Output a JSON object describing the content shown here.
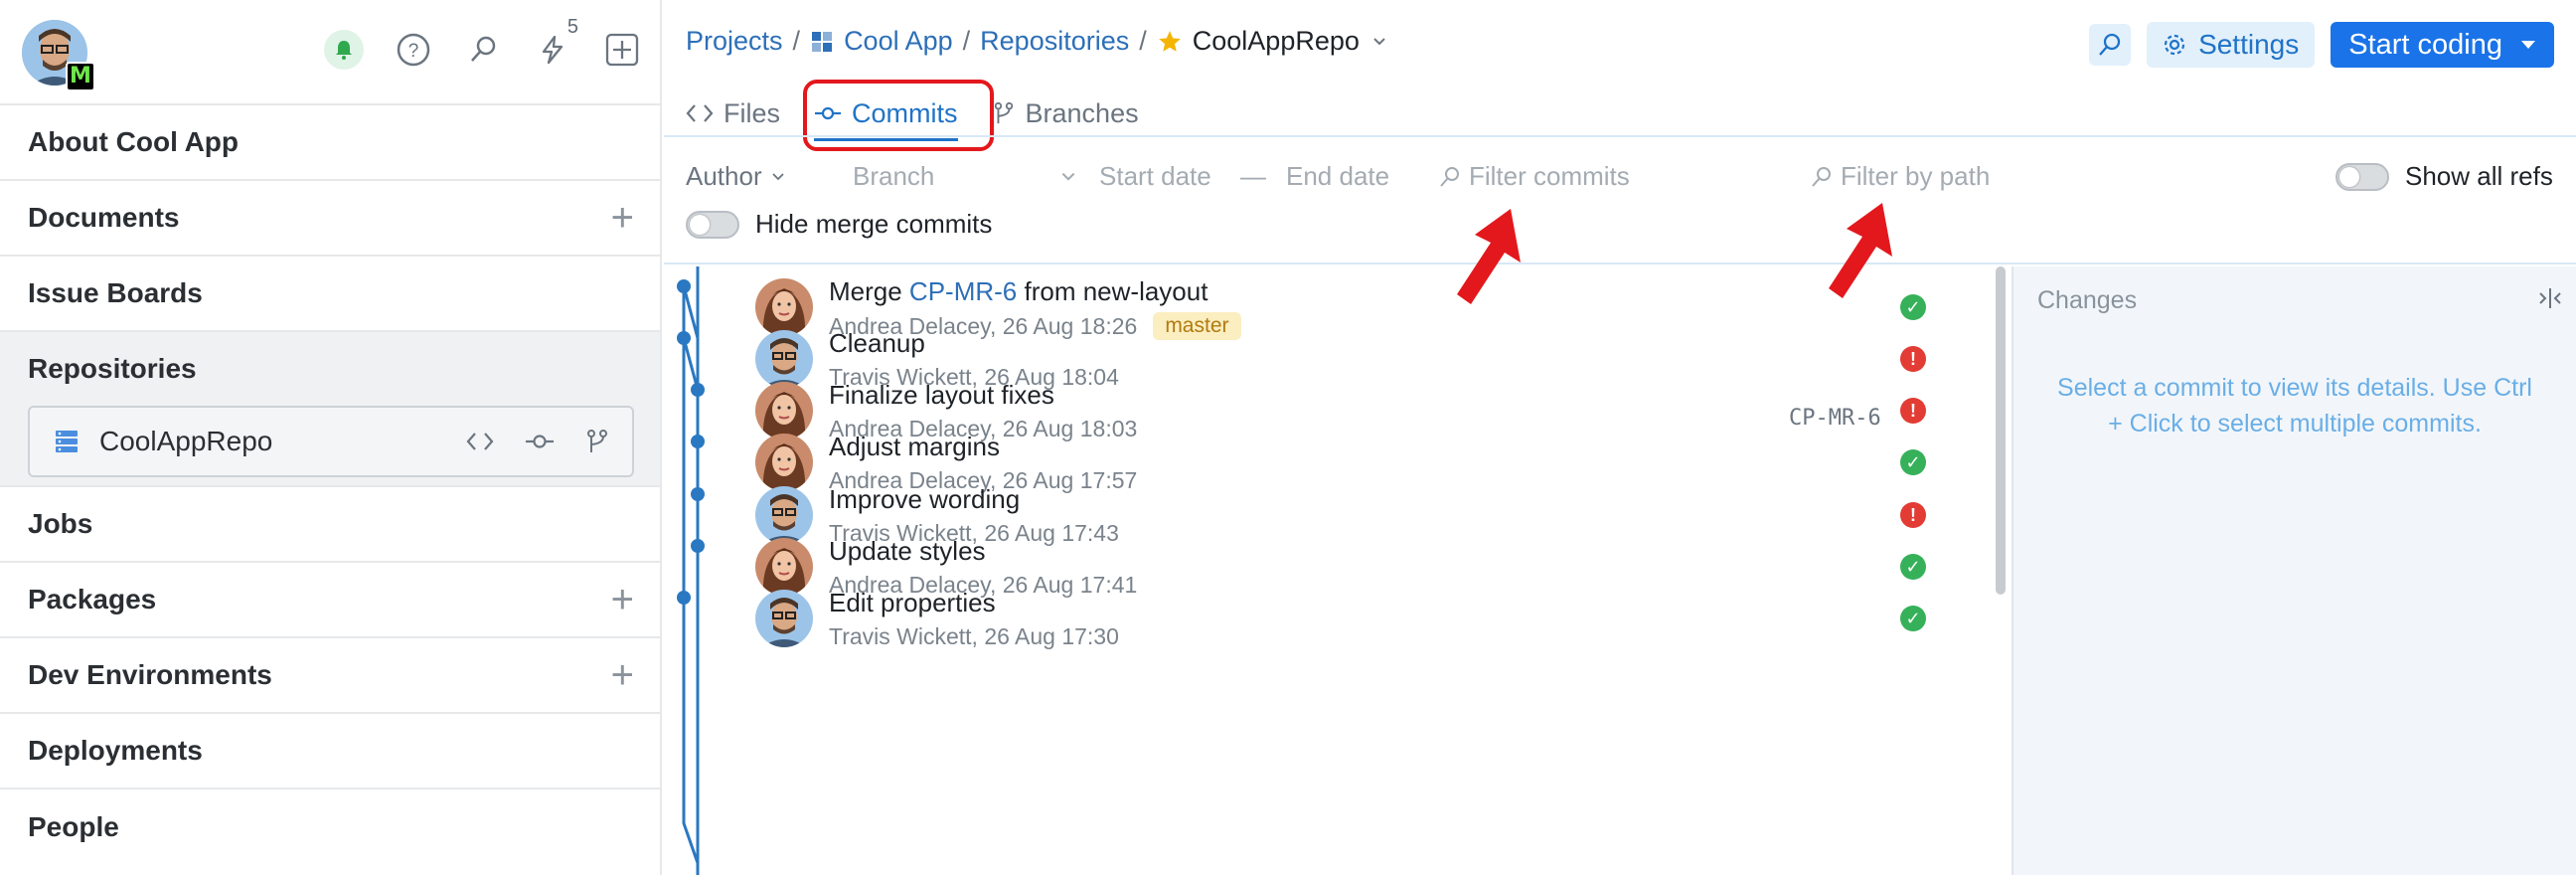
{
  "sidebar": {
    "notifications_count": "5",
    "avatar_badge": "M",
    "items": [
      {
        "label": "About Cool App",
        "has_add": false
      },
      {
        "label": "Documents",
        "has_add": true
      },
      {
        "label": "Issue Boards",
        "has_add": false
      }
    ],
    "repositories": {
      "label": "Repositories",
      "repo_name": "CoolAppRepo"
    },
    "items_after": [
      {
        "label": "Jobs",
        "has_add": false
      },
      {
        "label": "Packages",
        "has_add": true
      },
      {
        "label": "Dev Environments",
        "has_add": true
      },
      {
        "label": "Deployments",
        "has_add": false
      },
      {
        "label": "People",
        "has_add": false
      }
    ]
  },
  "breadcrumb": {
    "projects": "Projects",
    "project": "Cool App",
    "section": "Repositories",
    "repo": "CoolAppRepo",
    "sep": "/"
  },
  "toolbar": {
    "settings": "Settings",
    "start_coding": "Start coding"
  },
  "tabs": [
    {
      "label": "Files",
      "icon": "code-icon",
      "active": false
    },
    {
      "label": "Commits",
      "icon": "commit-icon",
      "active": true
    },
    {
      "label": "Branches",
      "icon": "branch-icon",
      "active": false
    }
  ],
  "filters": {
    "author": "Author",
    "branch": "Branch",
    "start_date": "Start date",
    "date_sep": "—",
    "end_date": "End date",
    "filter_commits": "Filter commits",
    "filter_path": "Filter by path",
    "show_all_refs": "Show all refs",
    "hide_merge": "Hide merge commits"
  },
  "commits": [
    {
      "title_pre": "Merge ",
      "title_link": "CP-MR-6",
      "title_post": " from new-layout",
      "meta": "Andrea Delacey, 26 Aug 18:26",
      "branch_tag": "master",
      "ref": "",
      "status": "ok",
      "author": "andrea"
    },
    {
      "title_pre": "Cleanup",
      "title_link": "",
      "title_post": "",
      "meta": "Travis Wickett, 26 Aug 18:04",
      "branch_tag": "",
      "ref": "",
      "status": "err",
      "author": "travis"
    },
    {
      "title_pre": "Finalize layout fixes",
      "title_link": "",
      "title_post": "",
      "meta": "Andrea Delacey, 26 Aug 18:03",
      "branch_tag": "",
      "ref": "CP-MR-6",
      "status": "err",
      "author": "andrea"
    },
    {
      "title_pre": "Adjust margins",
      "title_link": "",
      "title_post": "",
      "meta": "Andrea Delacey, 26 Aug 17:57",
      "branch_tag": "",
      "ref": "",
      "status": "ok",
      "author": "andrea"
    },
    {
      "title_pre": "Improve wording",
      "title_link": "",
      "title_post": "",
      "meta": "Travis Wickett, 26 Aug 17:43",
      "branch_tag": "",
      "ref": "",
      "status": "err",
      "author": "travis"
    },
    {
      "title_pre": "Update styles",
      "title_link": "",
      "title_post": "",
      "meta": "Andrea Delacey, 26 Aug 17:41",
      "branch_tag": "",
      "ref": "",
      "status": "ok",
      "author": "andrea"
    },
    {
      "title_pre": "Edit properties",
      "title_link": "",
      "title_post": "",
      "meta": "Travis Wickett, 26 Aug 17:30",
      "branch_tag": "",
      "ref": "",
      "status": "ok",
      "author": "travis"
    }
  ],
  "changes": {
    "header": "Changes",
    "empty_message": "Select a commit to view its details. Use Ctrl + Click to select multiple commits."
  },
  "colors": {
    "accent": "#1a73e8",
    "link": "#2d6fb8",
    "ok": "#36b15a",
    "error": "#e23c34",
    "annotation": "#e3181d"
  }
}
